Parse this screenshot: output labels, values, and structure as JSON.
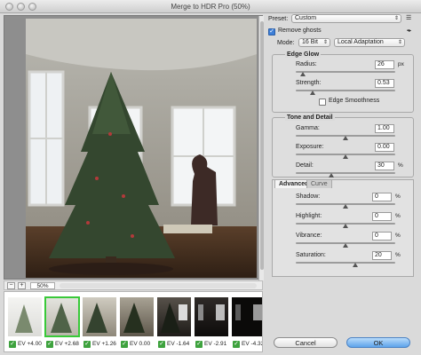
{
  "window": {
    "title": "Merge to HDR Pro (50%)"
  },
  "preview": {
    "zoom_value": "50%",
    "zoom_minus": "−",
    "zoom_plus": "+"
  },
  "filmstrip": [
    {
      "label": "EV +4.00",
      "checked": true
    },
    {
      "label": "EV +2.68",
      "checked": true,
      "selected": true
    },
    {
      "label": "EV +1.26",
      "checked": true
    },
    {
      "label": "EV 0.00",
      "checked": true
    },
    {
      "label": "EV -1.64",
      "checked": true
    },
    {
      "label": "EV -2.91",
      "checked": true
    },
    {
      "label": "EV -4.32",
      "checked": true
    }
  ],
  "settings": {
    "preset_label": "Preset:",
    "preset_value": "Custom",
    "remove_ghosts_label": "Remove ghosts",
    "remove_ghosts_checked": true,
    "mode_label": "Mode:",
    "mode_bits": "16 Bit",
    "mode_method": "Local Adaptation"
  },
  "edge_glow": {
    "title": "Edge Glow",
    "radius_label": "Radius:",
    "radius_value": "26",
    "radius_unit": "px",
    "strength_label": "Strength:",
    "strength_value": "0.53",
    "edge_smoothness_label": "Edge Smoothness",
    "edge_smoothness_checked": false
  },
  "tone_detail": {
    "title": "Tone and Detail",
    "gamma_label": "Gamma:",
    "gamma_value": "1.00",
    "exposure_label": "Exposure:",
    "exposure_value": "0.00",
    "detail_label": "Detail:",
    "detail_value": "30",
    "detail_unit": "%"
  },
  "tabs": {
    "advanced": "Advanced",
    "curve": "Curve"
  },
  "advanced": {
    "shadow_label": "Shadow:",
    "shadow_value": "0",
    "highlight_label": "Highlight:",
    "highlight_value": "0",
    "vibrance_label": "Vibrance:",
    "vibrance_value": "0",
    "saturation_label": "Saturation:",
    "saturation_value": "20",
    "unit": "%"
  },
  "buttons": {
    "cancel": "Cancel",
    "ok": "OK"
  }
}
